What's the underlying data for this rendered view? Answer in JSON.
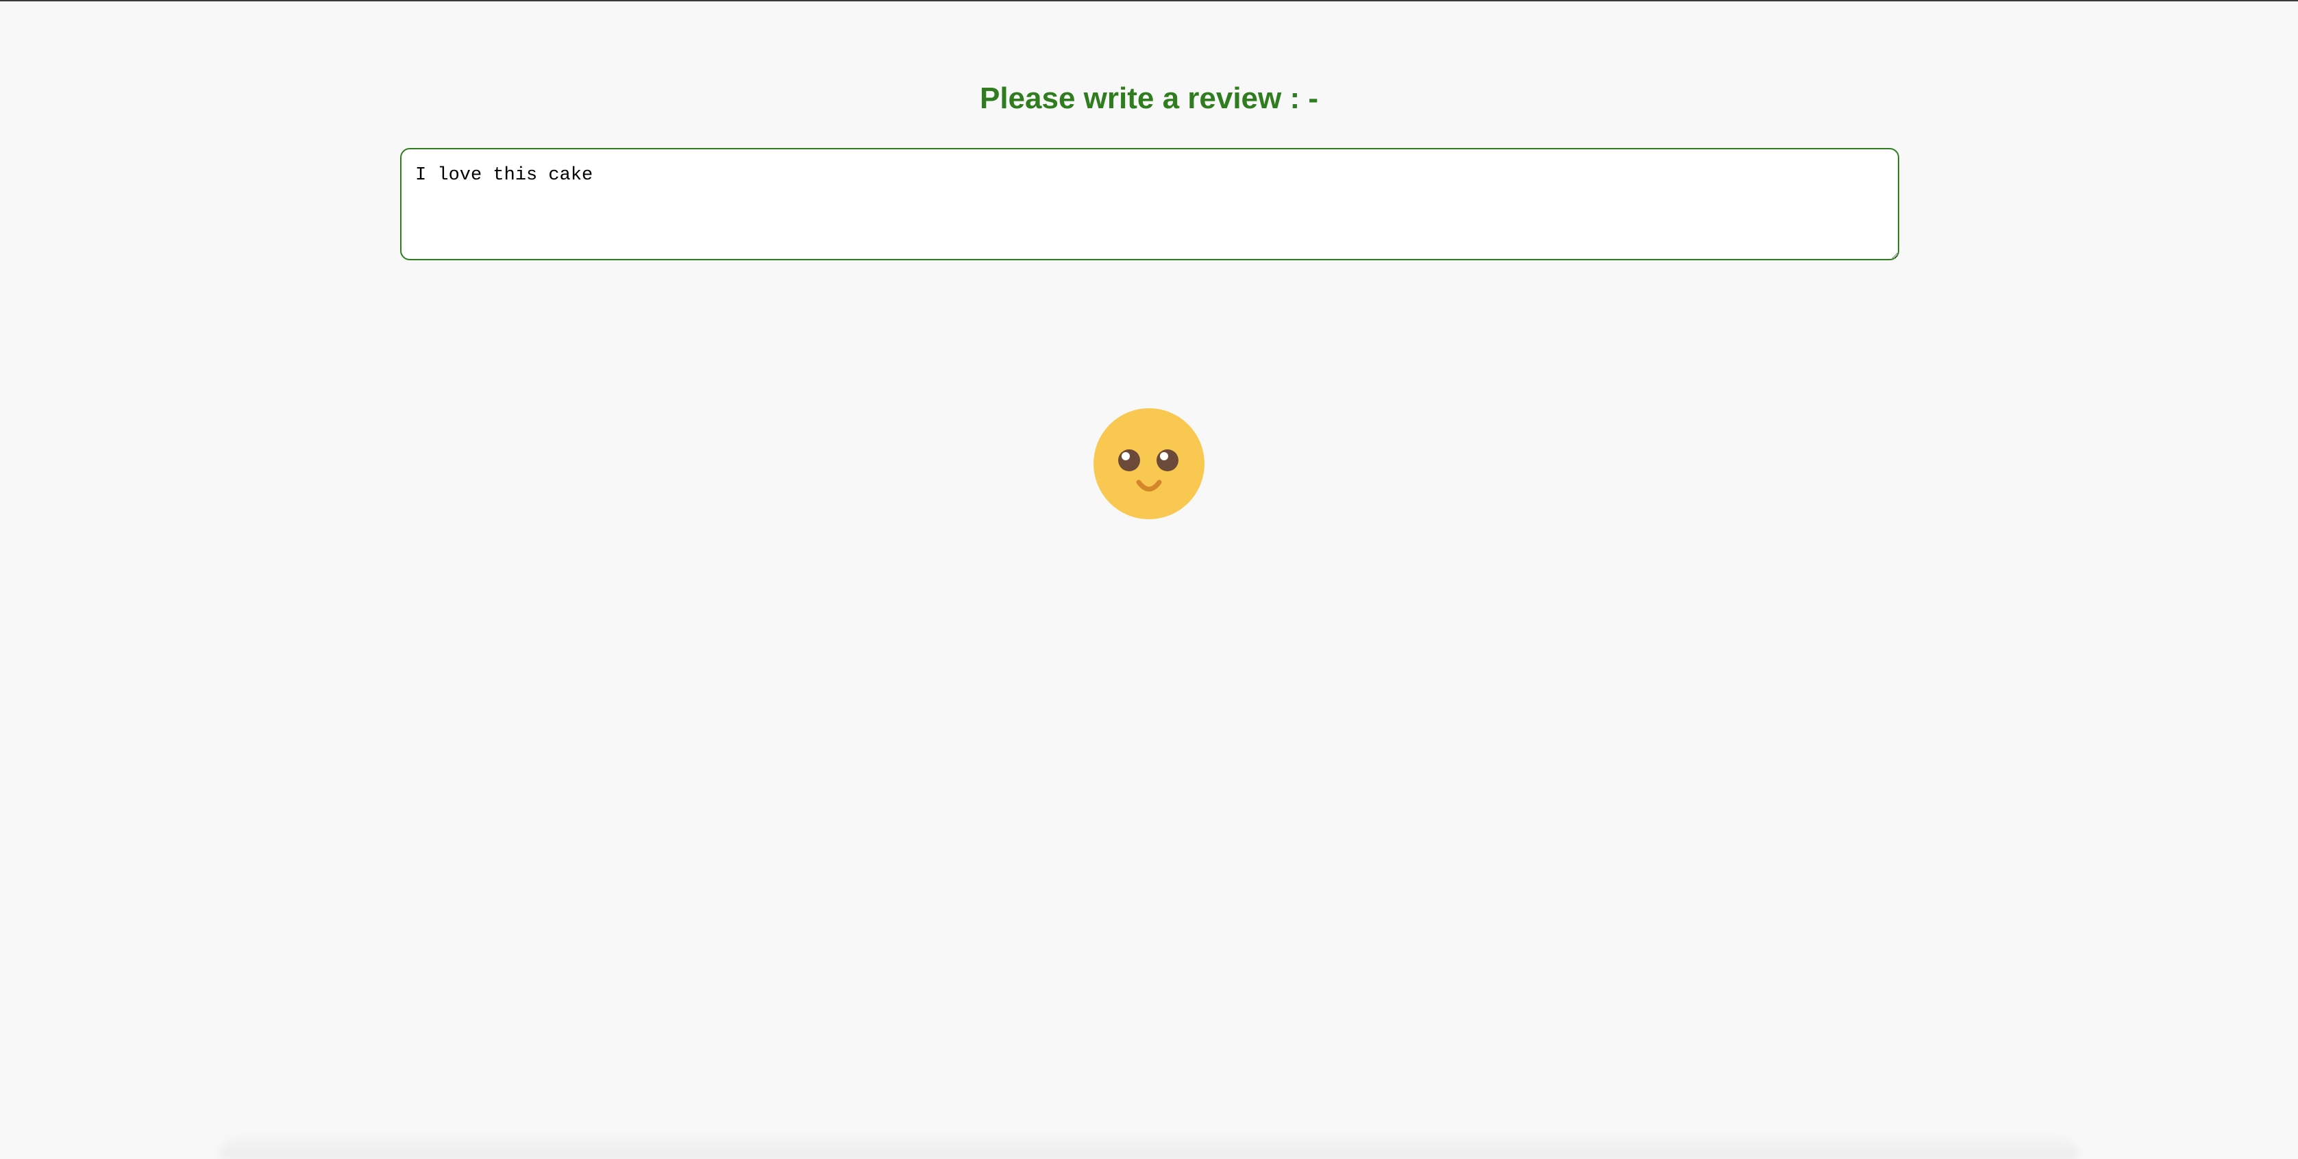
{
  "page": {
    "heading": "Please write a review : -"
  },
  "review": {
    "value": "I love this cake"
  },
  "emoji": {
    "icon": "smiling-face-icon",
    "face_color": "#f8c850",
    "eye_color": "#6b4a3a",
    "mouth_color": "#d4862a"
  },
  "theme": {
    "accent": "#2f7d1f",
    "background": "#f8f8f8"
  }
}
